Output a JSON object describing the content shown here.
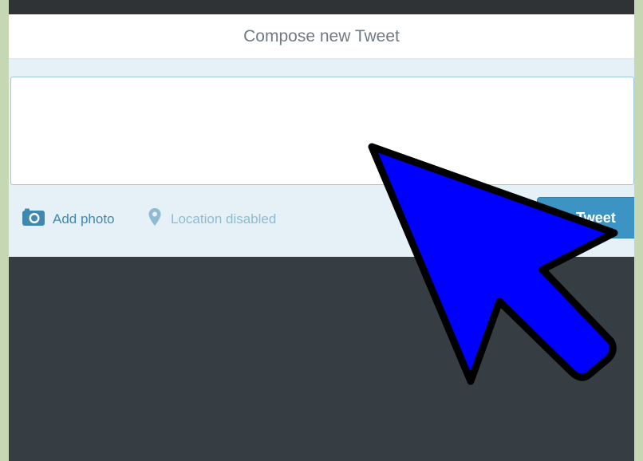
{
  "header": {
    "title": "Compose new Tweet"
  },
  "compose": {
    "text_value": "",
    "placeholder": ""
  },
  "toolbar": {
    "add_photo_label": "Add photo",
    "location_label": "Location disabled",
    "tweet_label": "Tweet"
  },
  "icons": {
    "add_photo": "camera-icon",
    "location": "map-pin-icon",
    "tweet": "quill-icon",
    "overlay": "pointer-arrow-icon"
  },
  "colors": {
    "accent": "#3c94c5",
    "compose_bg": "#e6f1f7",
    "page_bg": "#363e43",
    "arrow_fill": "#0000ff",
    "arrow_stroke": "#000000"
  }
}
